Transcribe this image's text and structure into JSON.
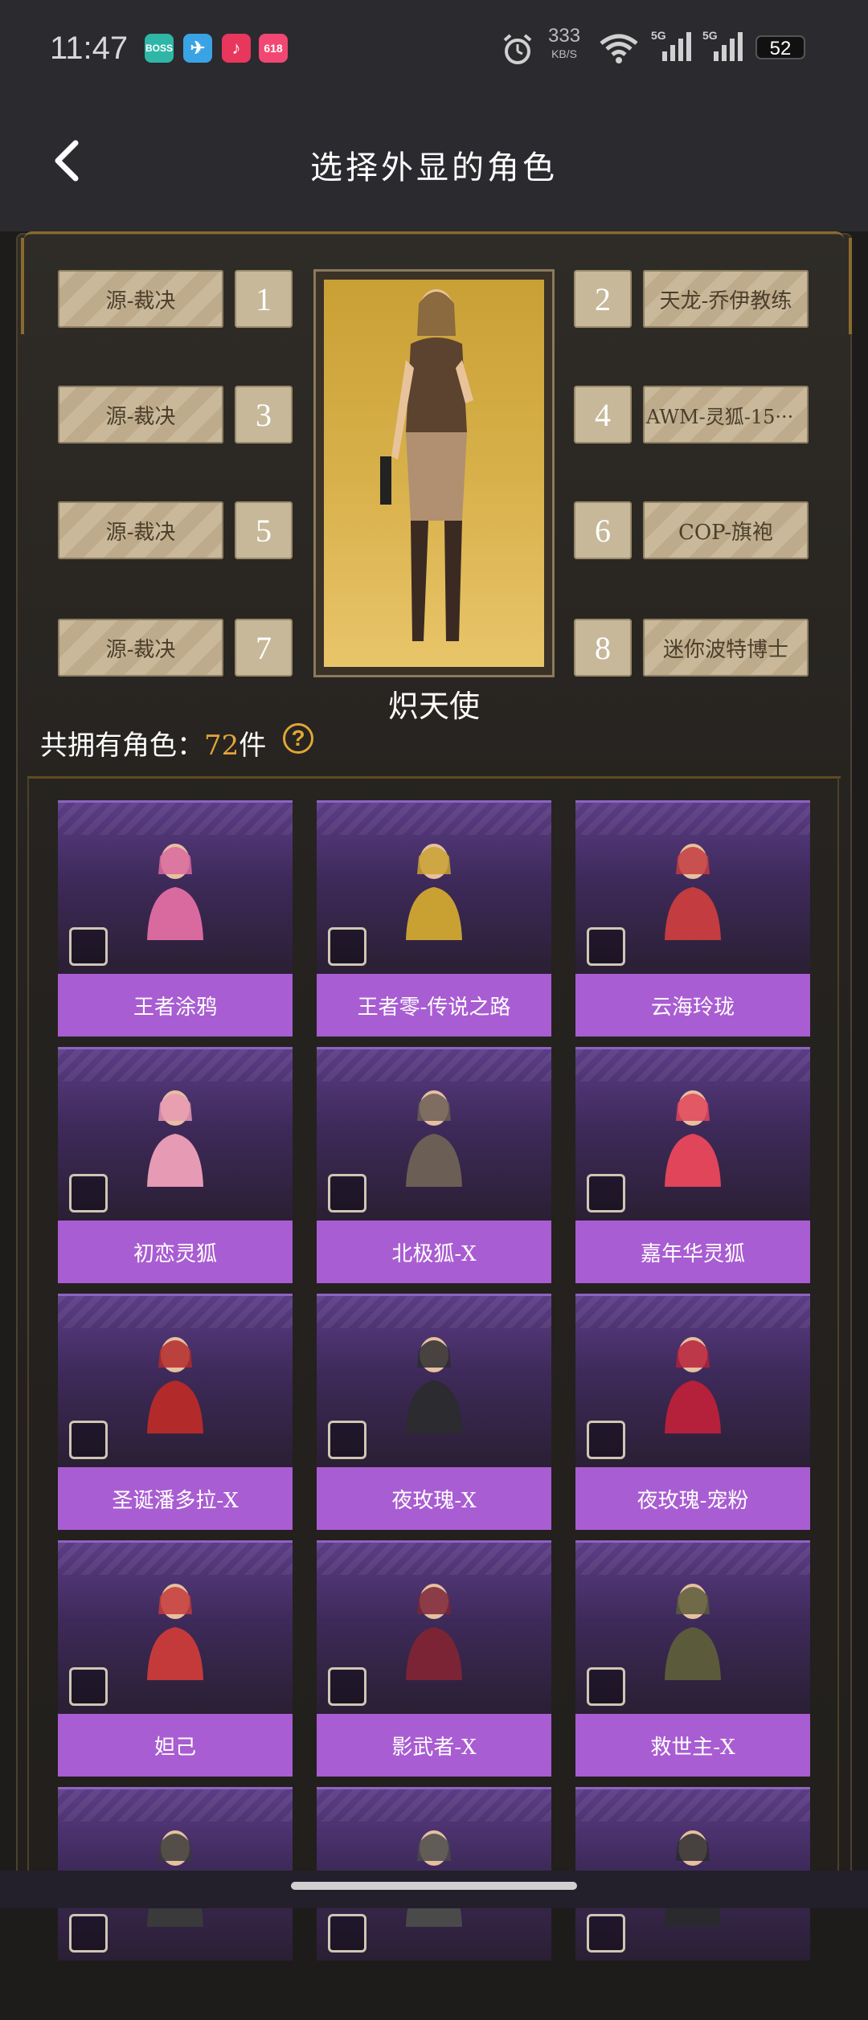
{
  "status_bar": {
    "time": "11:47",
    "apps": [
      {
        "name": "boss-app-icon",
        "label": "BOSS",
        "color": "#2fb6a6"
      },
      {
        "name": "telegram-app-icon",
        "label": "✈",
        "color": "#3aa3e3"
      },
      {
        "name": "douyin-app-icon",
        "label": "♪",
        "color": "#e8365d"
      },
      {
        "name": "taobao-app-icon",
        "label": "618",
        "color": "#f24773"
      }
    ],
    "net_speed": "333",
    "net_unit": "KB/S",
    "signal1": "5G",
    "signal2": "5G",
    "battery": "52"
  },
  "header": {
    "title": "选择外显的角色"
  },
  "slots": [
    {
      "num": "1",
      "label": "源-裁决"
    },
    {
      "num": "2",
      "label": "天龙-乔伊教练"
    },
    {
      "num": "3",
      "label": "源-裁决"
    },
    {
      "num": "4",
      "label": "AWM-灵狐-15···"
    },
    {
      "num": "5",
      "label": "源-裁决"
    },
    {
      "num": "6",
      "label": "COP-旗袍"
    },
    {
      "num": "7",
      "label": "源-裁决"
    },
    {
      "num": "8",
      "label": "迷你波特博士"
    }
  ],
  "preview": {
    "name": "炽天使"
  },
  "owned": {
    "prefix": "共拥有角色：",
    "count": "72",
    "suffix": "件"
  },
  "characters": [
    {
      "label": "王者涂鸦",
      "color": "#d96aa0"
    },
    {
      "label": "王者零-传说之路",
      "color": "#c9a133"
    },
    {
      "label": "云海玲珑",
      "color": "#c23c40"
    },
    {
      "label": "初恋灵狐",
      "color": "#e79ab4"
    },
    {
      "label": "北极狐-X",
      "color": "#6b5e55"
    },
    {
      "label": "嘉年华灵狐",
      "color": "#e0455a"
    },
    {
      "label": "圣诞潘多拉-X",
      "color": "#b32a2a"
    },
    {
      "label": "夜玫瑰-X",
      "color": "#2b2b30"
    },
    {
      "label": "夜玫瑰-宠粉",
      "color": "#b5203a"
    },
    {
      "label": "妲己",
      "color": "#c43a3a"
    },
    {
      "label": "影武者-X",
      "color": "#7a2436"
    },
    {
      "label": "救世主-X",
      "color": "#5b5a3a"
    },
    {
      "label": "",
      "color": "#3a3a3a"
    },
    {
      "label": "",
      "color": "#4a4a4a"
    },
    {
      "label": "",
      "color": "#2a2a2e"
    }
  ]
}
